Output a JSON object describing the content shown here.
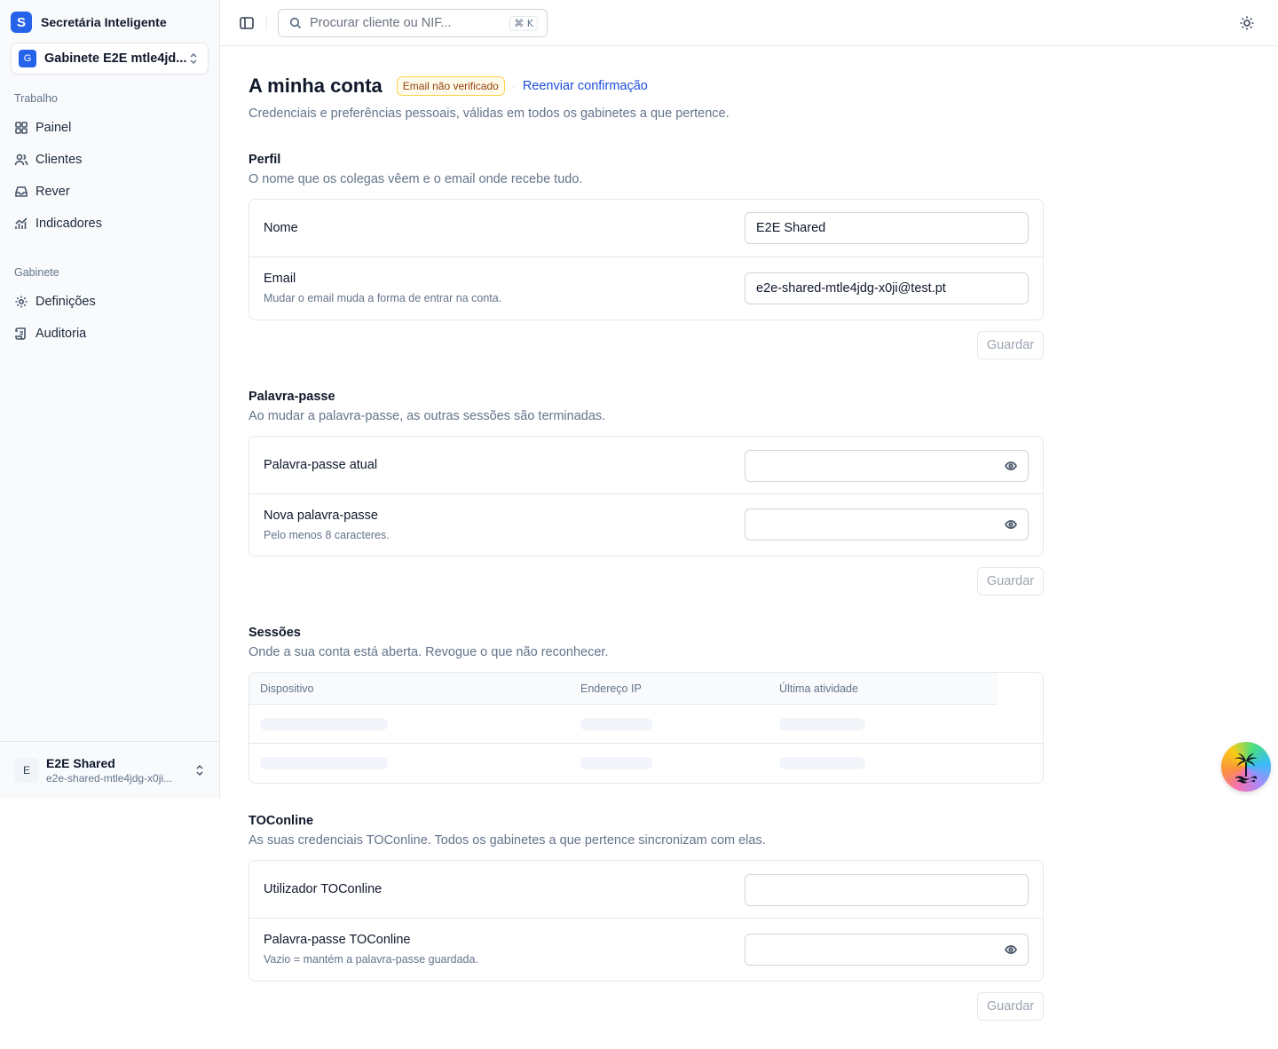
{
  "brand": {
    "logo_letter": "S",
    "name": "Secretária Inteligente",
    "color": "#2563eb"
  },
  "org": {
    "avatar": "G",
    "name": "Gabinete E2E mtle4jd..."
  },
  "nav": {
    "group_work": "Trabalho",
    "group_office": "Gabinete",
    "items": [
      {
        "label": "Painel",
        "icon": "grid-icon"
      },
      {
        "label": "Clientes",
        "icon": "users-icon"
      },
      {
        "label": "Rever",
        "icon": "inbox-icon"
      },
      {
        "label": "Indicadores",
        "icon": "chart-icon"
      },
      {
        "label": "Definições",
        "icon": "gear-icon"
      },
      {
        "label": "Auditoria",
        "icon": "scroll-icon"
      }
    ]
  },
  "user": {
    "avatar": "E",
    "name": "E2E Shared",
    "email": "e2e-shared-mtle4jdg-x0ji..."
  },
  "topbar": {
    "search_placeholder": "Procurar cliente ou NIF...",
    "shortcut": "⌘ K"
  },
  "page": {
    "title": "A minha conta",
    "badge": "Email não verificado",
    "resend": "Reenviar confirmação",
    "subtitle": "Credenciais e preferências pessoais, válidas em todos os gabinetes a que pertence."
  },
  "profile": {
    "title": "Perfil",
    "desc": "O nome que os colegas vêem e o email onde recebe tudo.",
    "name_label": "Nome",
    "name_value": "E2E Shared",
    "email_label": "Email",
    "email_hint": "Mudar o email muda a forma de entrar na conta.",
    "email_value": "e2e-shared-mtle4jdg-x0ji@test.pt",
    "save": "Guardar"
  },
  "password": {
    "title": "Palavra-passe",
    "desc": "Ao mudar a palavra-passe, as outras sessões são terminadas.",
    "current_label": "Palavra-passe atual",
    "new_label": "Nova palavra-passe",
    "new_hint": "Pelo menos 8 caracteres.",
    "save": "Guardar"
  },
  "sessions": {
    "title": "Sessões",
    "desc": "Onde a sua conta está aberta. Revogue o que não reconhecer.",
    "columns": [
      "Dispositivo",
      "Endereço IP",
      "Última atividade"
    ]
  },
  "toconline": {
    "title": "TOConline",
    "desc": "As suas credenciais TOConline. Todos os gabinetes a que pertence sincronizam com elas.",
    "user_label": "Utilizador TOConline",
    "pass_label": "Palavra-passe TOConline",
    "pass_hint": "Vazio = mantém a palavra-passe guardada.",
    "save": "Guardar"
  }
}
